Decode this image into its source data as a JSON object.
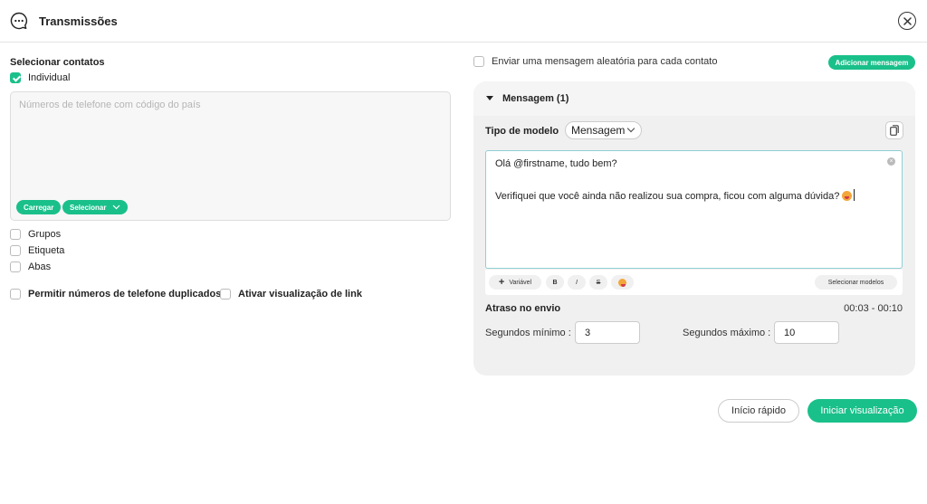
{
  "header": {
    "title": "Transmissões",
    "icon": "chat-dots-icon",
    "close_icon": "close-icon"
  },
  "contacts": {
    "section_label": "Selecionar contatos",
    "individual_label": "Individual",
    "individual_checked": true,
    "phone_placeholder": "Números de telefone com código do país",
    "phone_value": "",
    "upload_label": "Carregar",
    "select_label": "Selecionar",
    "groups_label": "Grupos",
    "tag_label": "Etiqueta",
    "tabs_label": "Abas",
    "allow_duplicates_label": "Permitir números de telefone duplicados",
    "link_preview_label": "Ativar visualização de link"
  },
  "message": {
    "random_label": "Enviar uma mensagem aleatória para cada contato",
    "add_message_label": "Adicionar mensagem",
    "panel_title": "Mensagem (1)",
    "template_type_label": "Tipo de modelo",
    "template_type_value": "Mensagem",
    "text_line1": "Olá @firstname, tudo bem?",
    "text_line2": "Verifiquei que você ainda não realizou sua compra, ficou com alguma dúvida?",
    "toolbar": {
      "variable_label": "Variável",
      "bold_label": "B",
      "italic_label": "I",
      "strike_label": "S",
      "emoji_icon": "emoji-icon",
      "select_templates_label": "Selecionar modelos"
    },
    "delay_label": "Atraso no envio",
    "delay_range": "00:03 - 00:10",
    "min_seconds_label": "Segundos mínimo :",
    "min_seconds_value": "3",
    "max_seconds_label": "Segundos máximo :",
    "max_seconds_value": "10"
  },
  "footer": {
    "quick_start_label": "Início rápido",
    "start_preview_label": "Iniciar visualização"
  },
  "colors": {
    "accent": "#1ac08a",
    "panel_bg": "#f0f0f0"
  }
}
